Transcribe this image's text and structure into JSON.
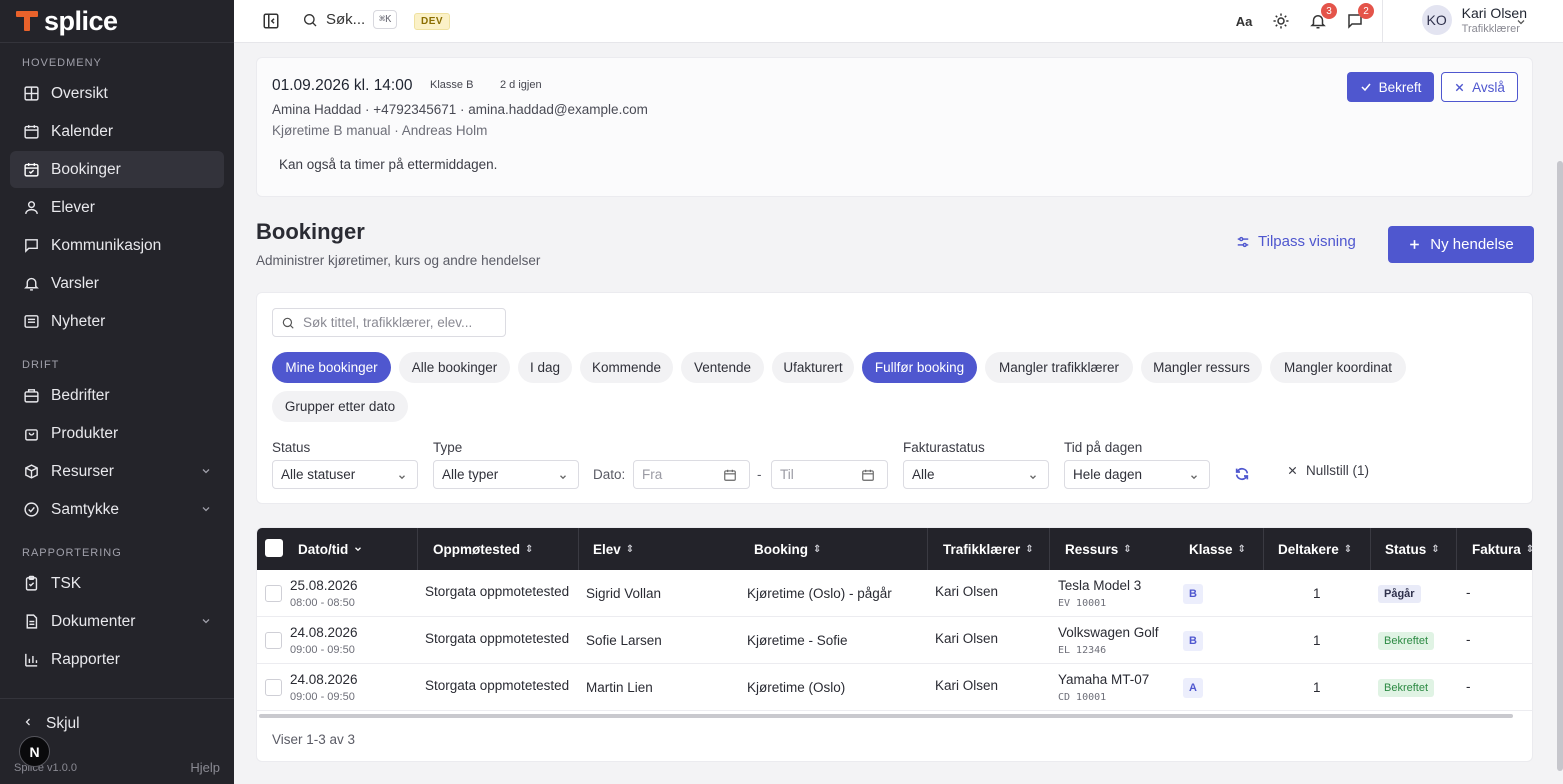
{
  "sidebar": {
    "logo_text": "splice",
    "sections": {
      "main": "HOVEDMENY",
      "drift": "DRIFT",
      "reporting": "RAPPORTERING"
    },
    "items": [
      {
        "label": "Oversikt",
        "icon": "grid-icon"
      },
      {
        "label": "Kalender",
        "icon": "calendar-icon"
      },
      {
        "label": "Bookinger",
        "icon": "calendar-check-icon"
      },
      {
        "label": "Elever",
        "icon": "user-icon"
      },
      {
        "label": "Kommunikasjon",
        "icon": "message-icon"
      },
      {
        "label": "Varsler",
        "icon": "bell-icon"
      },
      {
        "label": "Nyheter",
        "icon": "newspaper-icon"
      },
      {
        "label": "Bedrifter",
        "icon": "building-icon"
      },
      {
        "label": "Produkter",
        "icon": "bag-icon"
      },
      {
        "label": "Resurser",
        "icon": "cube-icon"
      },
      {
        "label": "Samtykke",
        "icon": "shield-check-icon"
      },
      {
        "label": "TSK",
        "icon": "clipboard-check-icon"
      },
      {
        "label": "Dokumenter",
        "icon": "document-icon"
      },
      {
        "label": "Rapporter",
        "icon": "bar-chart-icon"
      }
    ],
    "collapse_label": "Skjul",
    "version": "Splice v1.0.0",
    "help": "Hjelp",
    "n_badge": "N"
  },
  "topbar": {
    "search_label": "Søk...",
    "shortcut": "⌘K",
    "env_badge": "DEV",
    "notifications_count": "3",
    "messages_count": "2",
    "user": {
      "initials": "KO",
      "name": "Kari Olsen",
      "role": "Trafikklærer"
    }
  },
  "request": {
    "datetime": "01.09.2026 kl. 14:00",
    "class_tag": "Klasse B",
    "remaining": "2 d igjen",
    "contact": "Amina Haddad · +4792345671 · amina.haddad@example.com",
    "lesson": "Kjøretime B manual · Andreas Holm",
    "note": "Kan også ta timer på ettermiddagen.",
    "confirm_label": "Bekreft",
    "decline_label": "Avslå"
  },
  "page": {
    "title": "Bookinger",
    "subtitle": "Administrer kjøretimer, kurs og andre hendelser",
    "customize_label": "Tilpass visning",
    "new_label": "Ny hendelse"
  },
  "filters": {
    "search_placeholder": "Søk tittel, trafikklærer, elev...",
    "chips": [
      {
        "label": "Mine bookinger",
        "active": true
      },
      {
        "label": "Alle bookinger",
        "active": false
      },
      {
        "label": "I dag",
        "active": false
      },
      {
        "label": "Kommende",
        "active": false
      },
      {
        "label": "Ventende",
        "active": false
      },
      {
        "label": "Ufakturert",
        "active": false
      },
      {
        "label": "Fullfør booking",
        "active": true
      },
      {
        "label": "Mangler trafikklærer",
        "active": false
      },
      {
        "label": "Mangler ressurs",
        "active": false
      },
      {
        "label": "Mangler koordinat",
        "active": false
      },
      {
        "label": "Grupper etter dato",
        "active": false
      }
    ],
    "status_label": "Status",
    "status_value": "Alle statuser",
    "type_label": "Type",
    "type_value": "Alle typer",
    "date_label": "Dato:",
    "date_from": "Fra",
    "date_sep": "-",
    "date_to": "Til",
    "invoice_label": "Fakturastatus",
    "invoice_value": "Alle",
    "time_label": "Tid på dagen",
    "time_value": "Hele dagen",
    "reset_label": "Nullstill (1)"
  },
  "table": {
    "columns": [
      "Dato/tid",
      "Oppmøtested",
      "Elev",
      "Booking",
      "Trafikklærer",
      "Ressurs",
      "Klasse",
      "Deltakere",
      "Status",
      "Faktura"
    ],
    "rows": [
      {
        "date": "25.08.2026",
        "time": "08:00 - 08:50",
        "location": "Storgata oppmotetested",
        "student": "Sigrid Vollan",
        "booking": "Kjøretime (Oslo) - pågår",
        "teacher": "Kari Olsen",
        "resource": "Tesla Model 3",
        "plate": "EV 10001",
        "class": "B",
        "participants": "1",
        "status": "Pågår",
        "status_kind": "progress",
        "invoice": "-"
      },
      {
        "date": "24.08.2026",
        "time": "09:00 - 09:50",
        "location": "Storgata oppmotetested",
        "student": "Sofie Larsen",
        "booking": "Kjøretime - Sofie",
        "teacher": "Kari Olsen",
        "resource": "Volkswagen Golf",
        "plate": "EL 12346",
        "class": "B",
        "participants": "1",
        "status": "Bekreftet",
        "status_kind": "confirmed",
        "invoice": "-"
      },
      {
        "date": "24.08.2026",
        "time": "09:00 - 09:50",
        "location": "Storgata oppmotetested",
        "student": "Martin Lien",
        "booking": "Kjøretime (Oslo)",
        "teacher": "Kari Olsen",
        "resource": "Yamaha MT-07",
        "plate": "CD 10001",
        "class": "A",
        "participants": "1",
        "status": "Bekreftet",
        "status_kind": "confirmed",
        "invoice": "-"
      }
    ],
    "footer": "Viser 1-3 av 3"
  },
  "colors": {
    "accent": "#4f57cf",
    "sidebar_bg": "#24242a",
    "logo_orange": "#e9622b",
    "badge_red": "#e4544a"
  }
}
